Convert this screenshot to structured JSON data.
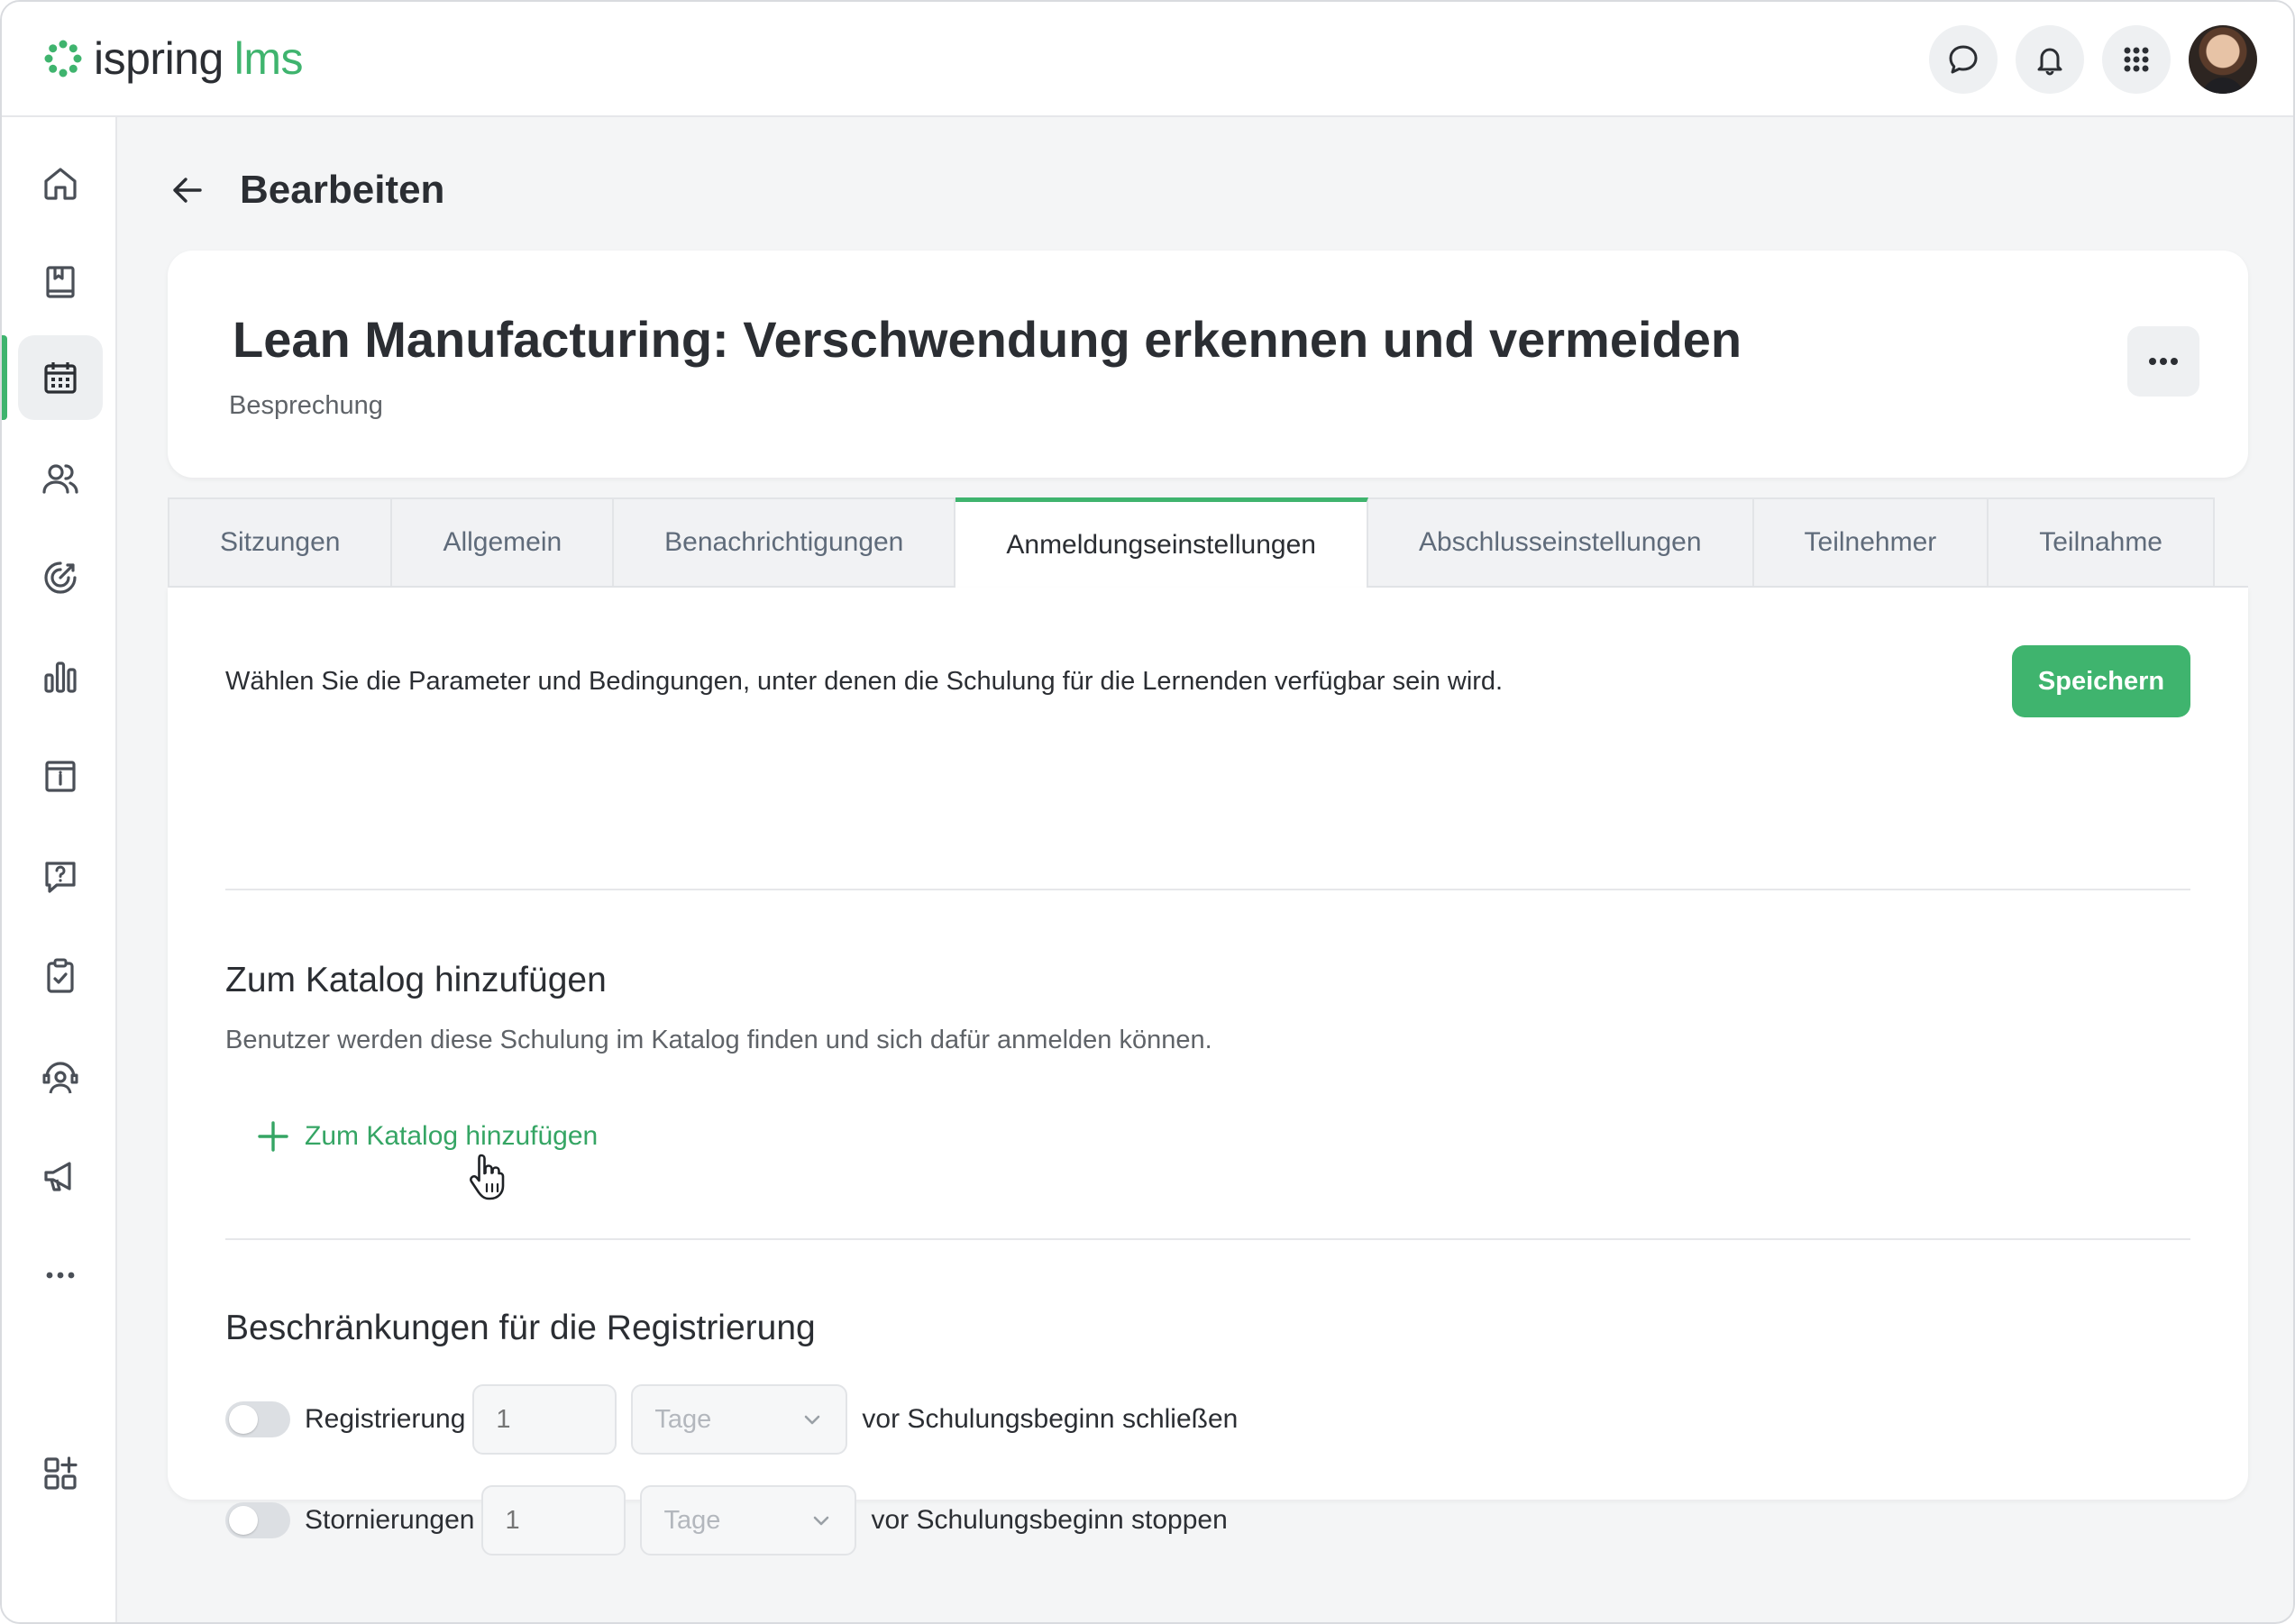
{
  "topbar": {
    "logo_text": "ispring",
    "logo_suffix": "lms",
    "brand_color": "#3fb46e",
    "actions": [
      "chat-icon",
      "bell-icon",
      "apps-grid-icon",
      "avatar"
    ]
  },
  "sidebar": {
    "items": [
      {
        "icon": "home-icon"
      },
      {
        "icon": "book-icon"
      },
      {
        "icon": "calendar-icon",
        "active": true
      },
      {
        "icon": "users-icon"
      },
      {
        "icon": "target-icon"
      },
      {
        "icon": "bar-chart-icon"
      },
      {
        "icon": "info-board-icon"
      },
      {
        "icon": "question-chat-icon"
      },
      {
        "icon": "clipboard-check-icon"
      },
      {
        "icon": "support-agent-icon"
      },
      {
        "icon": "megaphone-icon"
      },
      {
        "icon": "more-icon"
      },
      {
        "icon": "add-widget-icon"
      }
    ]
  },
  "page": {
    "title": "Bearbeiten"
  },
  "course": {
    "title": "Lean Manufacturing: Verschwendung erkennen und vermeiden",
    "type": "Besprechung"
  },
  "tabs": [
    {
      "label": "Sitzungen"
    },
    {
      "label": "Allgemein"
    },
    {
      "label": "Benachrichtigungen"
    },
    {
      "label": "Anmeldungseinstellungen",
      "active": true
    },
    {
      "label": "Abschlusseinstellungen"
    },
    {
      "label": "Teilnehmer"
    },
    {
      "label": "Teilnahme"
    }
  ],
  "content": {
    "intro": "Wählen Sie die Parameter und Bedingungen, unter denen die Schulung für die Lernenden verfügbar sein wird.",
    "save_label": "Speichern",
    "catalog": {
      "title": "Zum Katalog hinzufügen",
      "description": "Benutzer werden diese Schulung im Katalog finden und sich dafür anmelden können.",
      "add_label": "Zum Katalog hinzufügen"
    },
    "restrictions": {
      "title": "Beschränkungen für die Registrierung",
      "registration": {
        "label": "Registrierung",
        "value_placeholder": "1",
        "unit": "Tage",
        "suffix": "vor Schulungsbeginn schließen",
        "enabled": false
      },
      "cancellation": {
        "label": "Stornierungen",
        "value_placeholder": "1",
        "unit": "Tage",
        "suffix": "vor Schulungsbeginn stoppen",
        "enabled": false
      }
    }
  }
}
